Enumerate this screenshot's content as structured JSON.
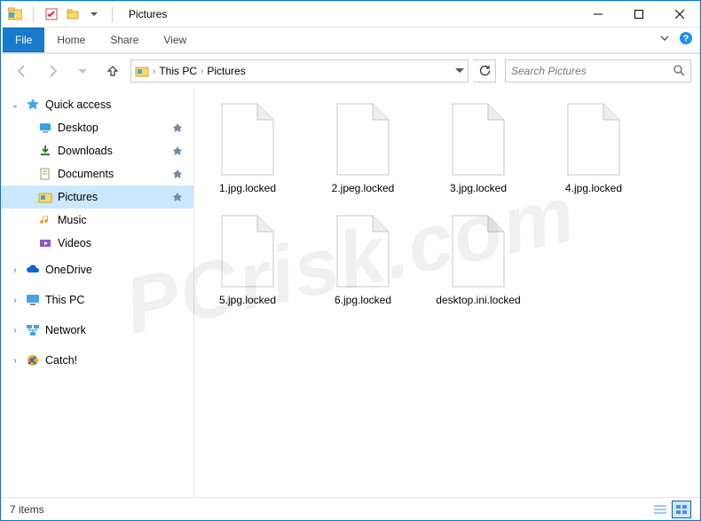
{
  "window": {
    "title": "Pictures"
  },
  "ribbon": {
    "file": "File",
    "tabs": [
      "Home",
      "Share",
      "View"
    ]
  },
  "breadcrumb": {
    "root_icon": "pictures",
    "items": [
      "This PC",
      "Pictures"
    ]
  },
  "search": {
    "placeholder": "Search Pictures"
  },
  "sidebar": {
    "quick_access": {
      "label": "Quick access",
      "expanded": true,
      "children": [
        {
          "label": "Desktop",
          "icon": "desktop",
          "pinned": true
        },
        {
          "label": "Downloads",
          "icon": "downloads",
          "pinned": true
        },
        {
          "label": "Documents",
          "icon": "documents",
          "pinned": true
        },
        {
          "label": "Pictures",
          "icon": "pictures",
          "pinned": true,
          "selected": true
        },
        {
          "label": "Music",
          "icon": "music"
        },
        {
          "label": "Videos",
          "icon": "videos"
        }
      ]
    },
    "onedrive": {
      "label": "OneDrive"
    },
    "thispc": {
      "label": "This PC"
    },
    "network": {
      "label": "Network"
    },
    "catch": {
      "label": "Catch!"
    }
  },
  "files": [
    {
      "name": "1.jpg.locked"
    },
    {
      "name": "2.jpeg.locked"
    },
    {
      "name": "3.jpg.locked"
    },
    {
      "name": "4.jpg.locked"
    },
    {
      "name": "5.jpg.locked"
    },
    {
      "name": "6.jpg.locked"
    },
    {
      "name": "desktop.ini.locked"
    }
  ],
  "status": {
    "item_count": "7 items"
  },
  "watermark": "PCrisk.com"
}
